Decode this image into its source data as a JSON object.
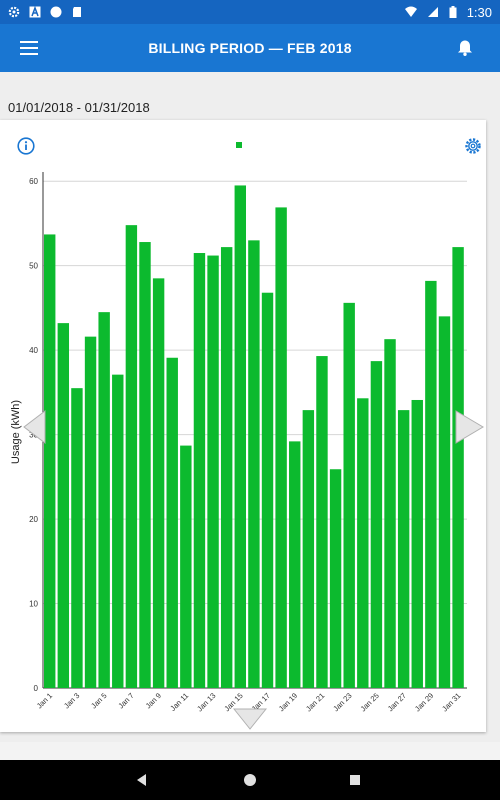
{
  "status_bar": {
    "time": "1:30",
    "left_icons": [
      "settings-icon",
      "a-icon",
      "circle-icon",
      "sd-card-icon"
    ],
    "right_icons": [
      "wifi-icon",
      "cellular-icon",
      "battery-icon"
    ]
  },
  "app_bar": {
    "title": "BILLING PERIOD  —  FEB 2018",
    "menu_icon": "menu-icon",
    "notification_icon": "bell-icon"
  },
  "date_range": "01/01/2018 - 01/31/2018",
  "colors": {
    "app_bar": "#1976d2",
    "status_bar": "#1565c0",
    "bar": "#0cba2e",
    "background": "#eeeeee"
  },
  "chart_data": {
    "type": "bar",
    "ylabel": "Usage (kWh)",
    "xlabel": "",
    "ylim": [
      0,
      60
    ],
    "yticks": [
      0,
      10,
      20,
      30,
      40,
      50,
      60
    ],
    "grid": true,
    "categories": [
      "Jan 1",
      "Jan 2",
      "Jan 3",
      "Jan 4",
      "Jan 5",
      "Jan 6",
      "Jan 7",
      "Jan 8",
      "Jan 9",
      "Jan 10",
      "Jan 11",
      "Jan 12",
      "Jan 13",
      "Jan 14",
      "Jan 15",
      "Jan 16",
      "Jan 17",
      "Jan 18",
      "Jan 19",
      "Jan 20",
      "Jan 21",
      "Jan 22",
      "Jan 23",
      "Jan 24",
      "Jan 25",
      "Jan 26",
      "Jan 27",
      "Jan 28",
      "Jan 29",
      "Jan 30",
      "Jan 31"
    ],
    "tick_labels": [
      "Jan 1",
      "Jan 3",
      "Jan 5",
      "Jan 7",
      "Jan 9",
      "Jan 11",
      "Jan 13",
      "Jan 15",
      "Jan 17",
      "Jan 19",
      "Jan 21",
      "Jan 23",
      "Jan 25",
      "Jan 27",
      "Jan 29",
      "Jan 31"
    ],
    "values": [
      53.7,
      43.2,
      35.5,
      41.6,
      44.5,
      37.1,
      54.8,
      52.8,
      48.5,
      39.1,
      28.7,
      51.5,
      51.2,
      52.2,
      59.5,
      53.0,
      46.8,
      56.9,
      29.2,
      32.9,
      39.3,
      25.9,
      45.6,
      34.3,
      38.7,
      41.3,
      32.9,
      34.1,
      48.2,
      44.0,
      52.2
    ]
  },
  "chart_nav": {
    "prev_icon": "chevron-left-icon",
    "next_icon": "chevron-right-icon",
    "expand_icon": "chevron-down-icon"
  },
  "system_nav": {
    "back_icon": "back-triangle-icon",
    "home_icon": "home-circle-icon",
    "recents_icon": "recents-square-icon"
  }
}
